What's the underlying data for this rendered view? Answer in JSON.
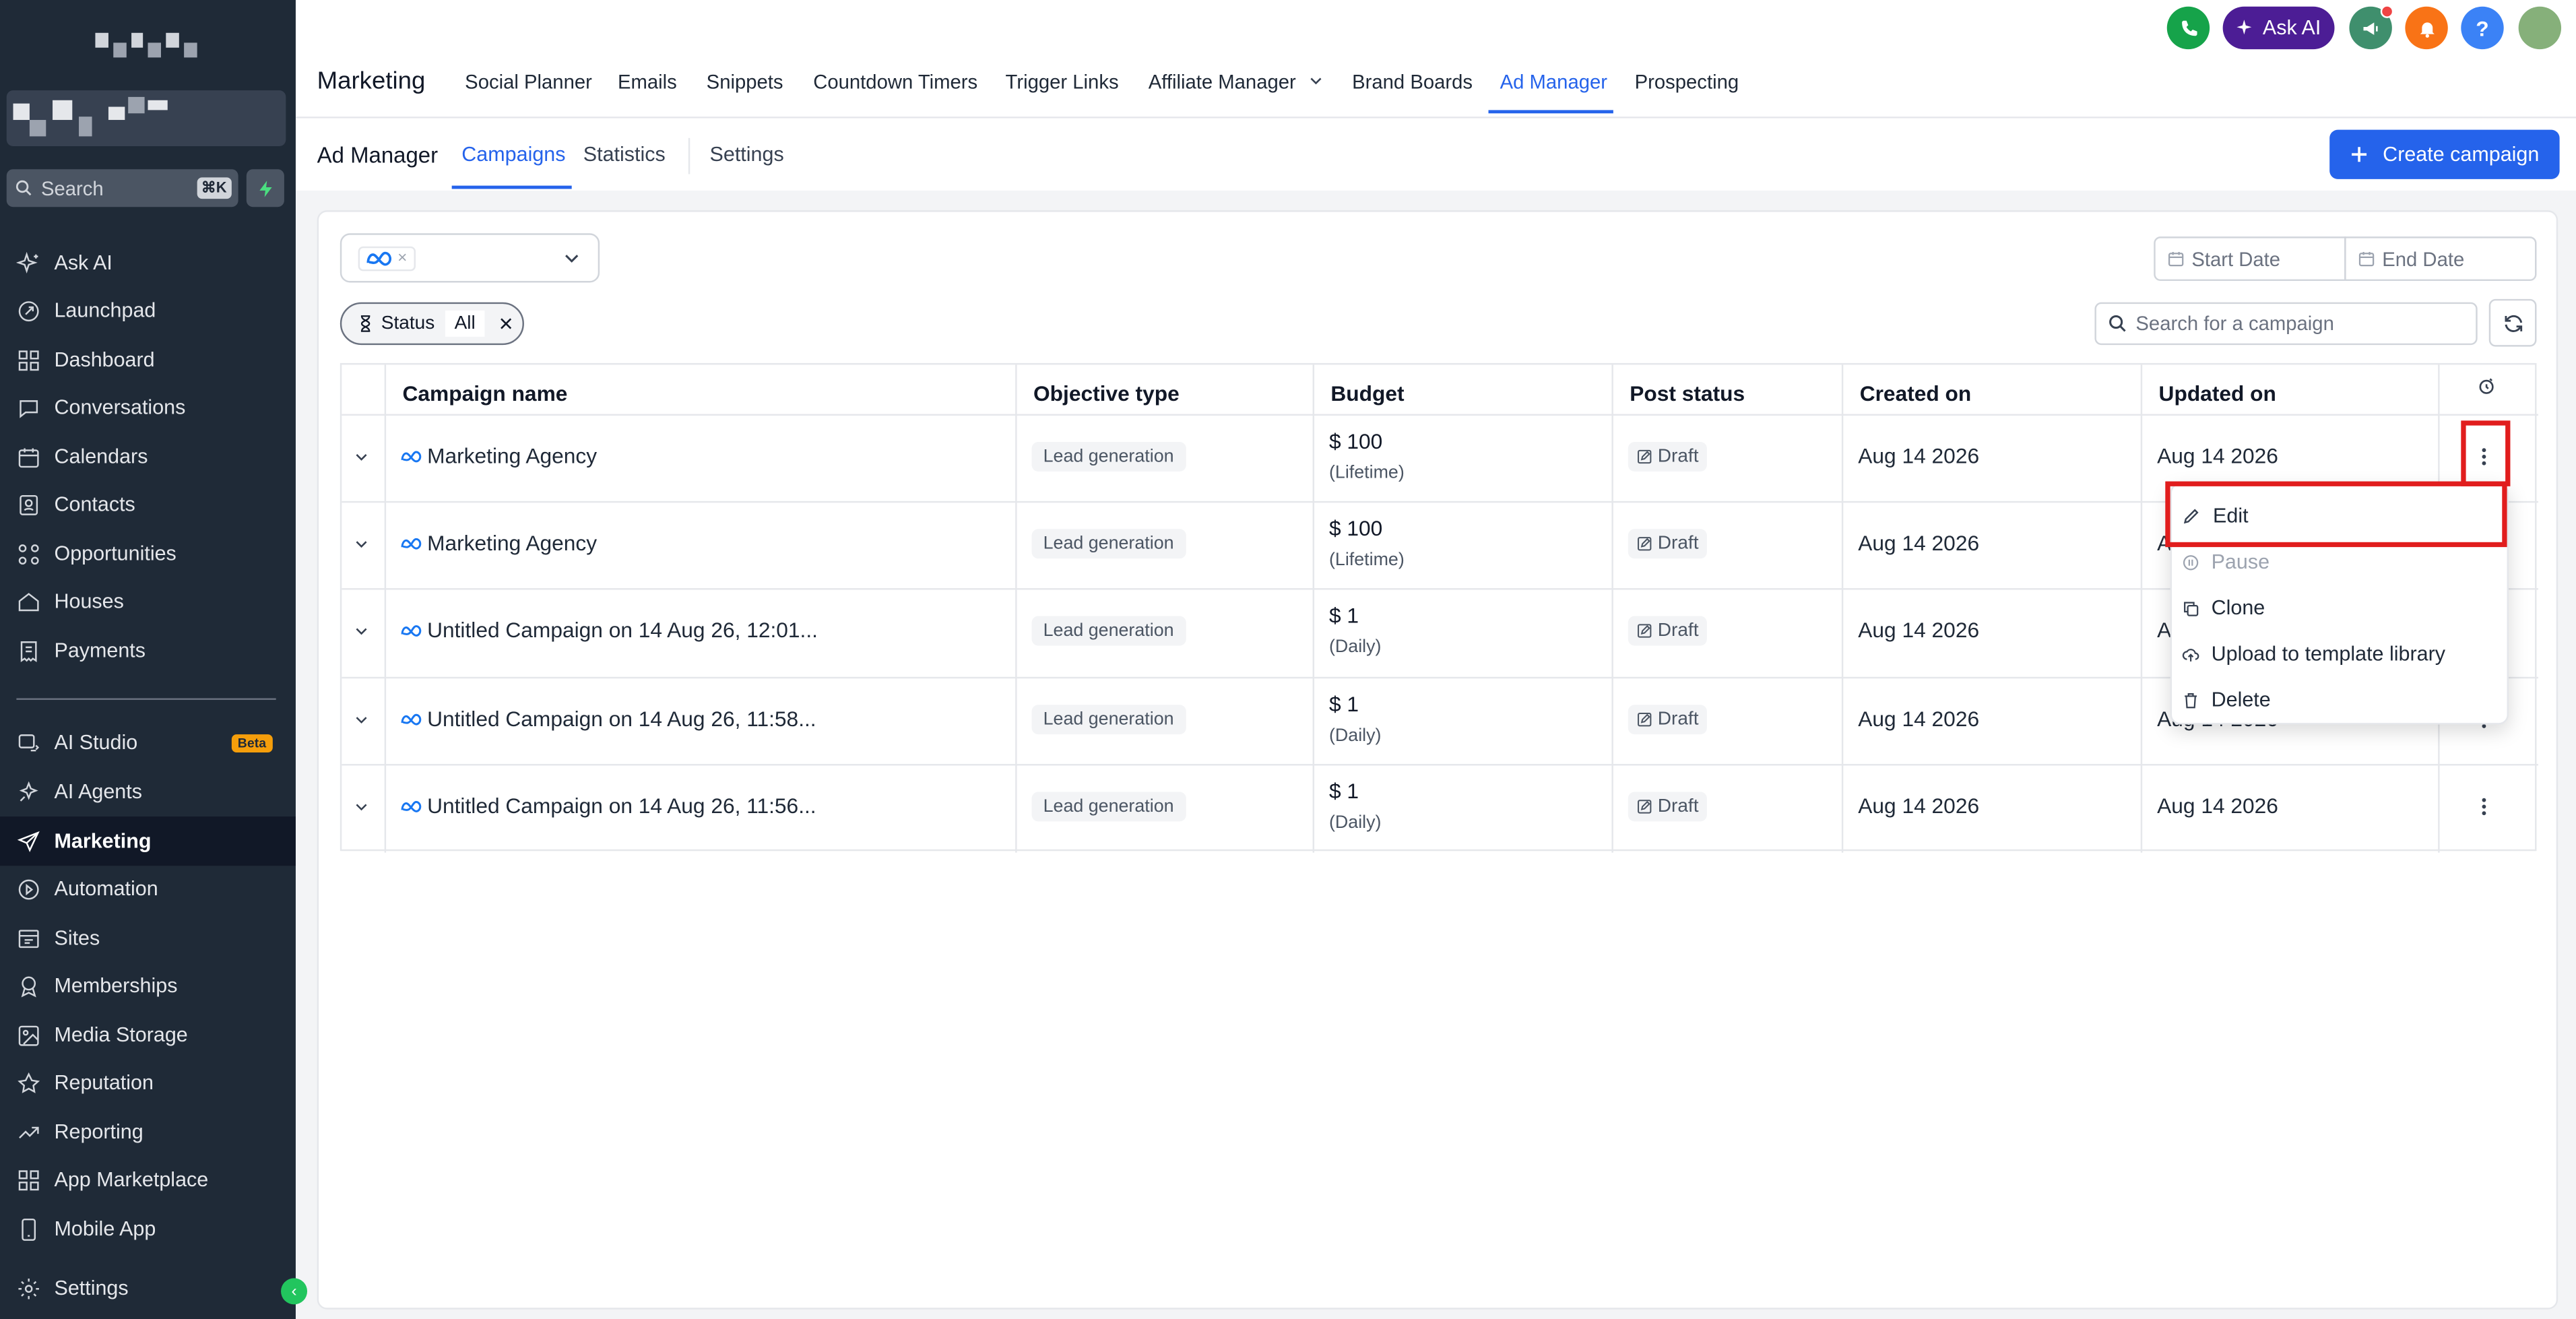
{
  "sidebar": {
    "search_placeholder": "Search",
    "search_shortcut": "⌘K",
    "items": [
      {
        "label": "Ask AI"
      },
      {
        "label": "Launchpad"
      },
      {
        "label": "Dashboard"
      },
      {
        "label": "Conversations"
      },
      {
        "label": "Calendars"
      },
      {
        "label": "Contacts"
      },
      {
        "label": "Opportunities"
      },
      {
        "label": "Houses"
      },
      {
        "label": "Payments"
      },
      {
        "label": "AI Studio",
        "badge": "Beta"
      },
      {
        "label": "AI Agents"
      },
      {
        "label": "Marketing"
      },
      {
        "label": "Automation"
      },
      {
        "label": "Sites"
      },
      {
        "label": "Memberships"
      },
      {
        "label": "Media Storage"
      },
      {
        "label": "Reputation"
      },
      {
        "label": "Reporting"
      },
      {
        "label": "App Marketplace"
      },
      {
        "label": "Mobile App"
      },
      {
        "label": "Settings"
      }
    ]
  },
  "header": {
    "title": "Marketing",
    "tabs": [
      "Social Planner",
      "Emails",
      "Snippets",
      "Countdown Timers",
      "Trigger Links",
      "Affiliate Manager",
      "Brand Boards",
      "Ad Manager",
      "Prospecting"
    ],
    "active_tab": "Ad Manager",
    "ask_ai_label": "Ask AI",
    "help_label": "?"
  },
  "subheader": {
    "title": "Ad Manager",
    "tabs": [
      "Campaigns",
      "Statistics",
      "Settings"
    ],
    "create_button": "Create campaign"
  },
  "filters": {
    "start_date_placeholder": "Start Date",
    "end_date_placeholder": "End Date",
    "status_label": "Status",
    "status_value": "All",
    "search_placeholder": "Search for a campaign"
  },
  "table": {
    "columns": [
      "Campaign name",
      "Objective type",
      "Budget",
      "Post status",
      "Created on",
      "Updated on"
    ],
    "rows": [
      {
        "name": "Marketing Agency",
        "objective": "Lead generation",
        "budget": "$ 100",
        "period": "(Lifetime)",
        "status": "Draft",
        "created": "Aug 14 2026",
        "updated": "Aug 14 2026"
      },
      {
        "name": "Marketing Agency",
        "objective": "Lead generation",
        "budget": "$ 100",
        "period": "(Lifetime)",
        "status": "Draft",
        "created": "Aug 14 2026",
        "updated": "A"
      },
      {
        "name": "Untitled Campaign on 14 Aug 26, 12:01...",
        "objective": "Lead generation",
        "budget": "$ 1",
        "period": "(Daily)",
        "status": "Draft",
        "created": "Aug 14 2026",
        "updated": "A"
      },
      {
        "name": "Untitled Campaign on 14 Aug 26, 11:58...",
        "objective": "Lead generation",
        "budget": "$ 1",
        "period": "(Daily)",
        "status": "Draft",
        "created": "Aug 14 2026",
        "updated": "Aug 14 2026"
      },
      {
        "name": "Untitled Campaign on 14 Aug 26, 11:56...",
        "objective": "Lead generation",
        "budget": "$ 1",
        "period": "(Daily)",
        "status": "Draft",
        "created": "Aug 14 2026",
        "updated": "Aug 14 2026"
      }
    ]
  },
  "row_menu": {
    "items": [
      {
        "label": "Edit",
        "icon": "pencil-icon"
      },
      {
        "label": "Pause",
        "icon": "pause-icon"
      },
      {
        "label": "Clone",
        "icon": "copy-icon"
      },
      {
        "label": "Upload to template library",
        "icon": "upload-icon"
      },
      {
        "label": "Delete",
        "icon": "trash-icon"
      }
    ]
  },
  "colors": {
    "accent": "#2563eb",
    "sidebar_bg": "#1f2a37",
    "highlight": "#e11d1d"
  }
}
